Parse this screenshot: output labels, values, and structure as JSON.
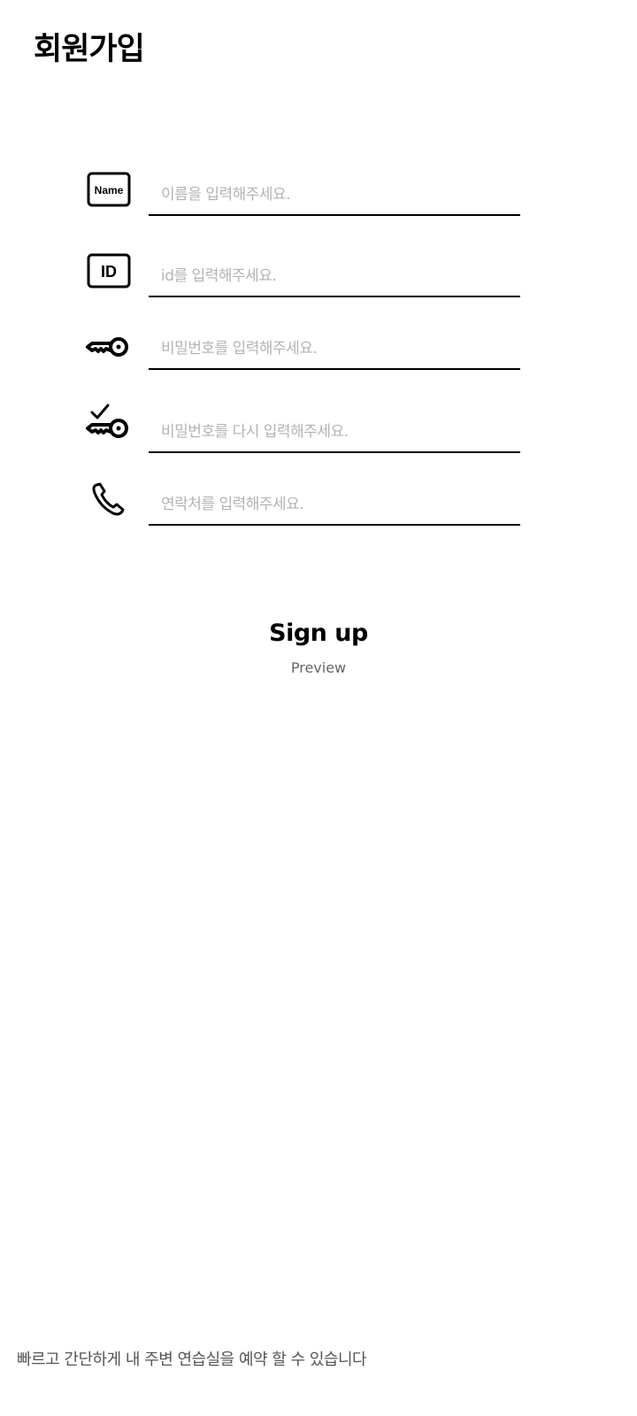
{
  "header": {
    "title": "회원가입"
  },
  "form": {
    "name": {
      "icon_label": "Name",
      "icon": "name-badge-icon",
      "placeholder": "이름을 입력해주세요.",
      "value": ""
    },
    "id": {
      "icon_label": "ID",
      "icon": "id-badge-icon",
      "placeholder": "id를 입력해주세요.",
      "value": ""
    },
    "password": {
      "icon": "key-icon",
      "placeholder": "비밀번호를 입력해주세요.",
      "value": ""
    },
    "password_confirm": {
      "icon": "key-check-icon",
      "placeholder": "비밀번호를 다시 입력해주세요.",
      "value": ""
    },
    "phone": {
      "icon": "phone-icon",
      "placeholder": "연락처를 입력해주세요.",
      "value": ""
    }
  },
  "actions": {
    "signup_label": "Sign up",
    "preview_label": "Preview"
  },
  "footer": {
    "text": "빠르고 간단하게 내 주변 연습실을 예약 할 수 있습니다"
  },
  "colors": {
    "text": "#000000",
    "placeholder": "#b3b3b3",
    "muted": "#666666",
    "background": "#ffffff"
  }
}
